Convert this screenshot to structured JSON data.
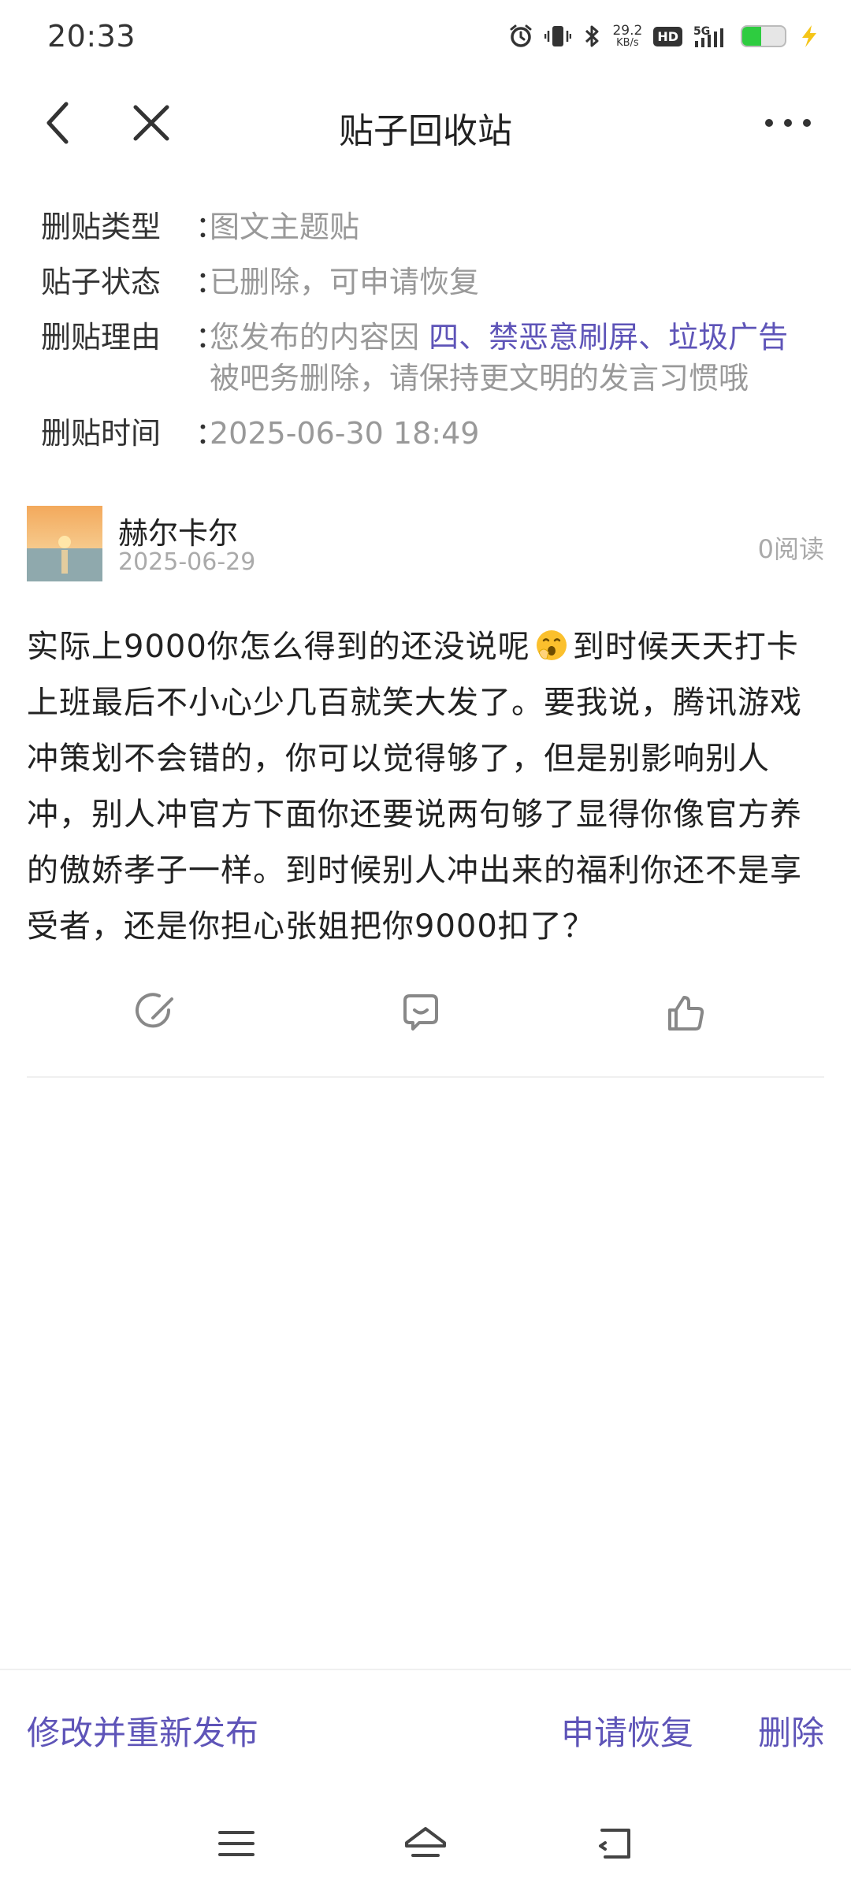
{
  "status_bar": {
    "time": "20:33",
    "net_speed_value": "29.2",
    "net_speed_unit": "KB/s",
    "hd_label": "HD",
    "network_label": "5G",
    "battery_level": 0.45,
    "icons": [
      "alarm-icon",
      "vibrate-icon",
      "bluetooth-icon",
      "hd-icon",
      "signal-5g-icon",
      "battery-icon",
      "charging-icon"
    ]
  },
  "navbar": {
    "title": "贴子回收站",
    "back_icon": "chevron-left-icon",
    "close_icon": "close-icon",
    "more_icon": "more-icon"
  },
  "info": {
    "type_label": "删贴类型",
    "type_value": "图文主题贴",
    "status_label": "贴子状态",
    "status_value": "已删除，可申请恢复",
    "reason_label": "删贴理由",
    "reason_prefix": "您发布的内容因 ",
    "reason_highlight": "四、禁恶意刷屏、垃圾广告",
    "reason_suffix": "被吧务删除，请保持更文明的发言习惯哦",
    "time_label": "删贴时间",
    "time_value": "2025-06-30 18:49",
    "separator": "："
  },
  "post": {
    "author": "赫尔卡尔",
    "date": "2025-06-29",
    "read_count": "0阅读",
    "content_part1": "实际上9000你怎么得到的还没说呢",
    "content_part2": "到时候天天打卡上班最后不小心少几百就笑大发了。要我说，腾讯游戏冲策划不会错的，你可以觉得够了，但是别影响别人冲，别人冲官方下面你还要说两句够了显得你像官方养的傲娇孝子一样。到时候别人冲出来的福利你还不是享受者，还是你担心张姐把你9000扣了？",
    "emoji": "yawning-face-emoji"
  },
  "actions": {
    "items": [
      "edit-icon",
      "comment-icon",
      "like-icon"
    ]
  },
  "bottom_bar": {
    "republish_label": "修改并重新发布",
    "restore_label": "申请恢复",
    "delete_label": "删除",
    "accent_color": "#5e54b8"
  },
  "system_nav": {
    "items": [
      "menu-icon",
      "home-icon",
      "back-icon"
    ]
  }
}
